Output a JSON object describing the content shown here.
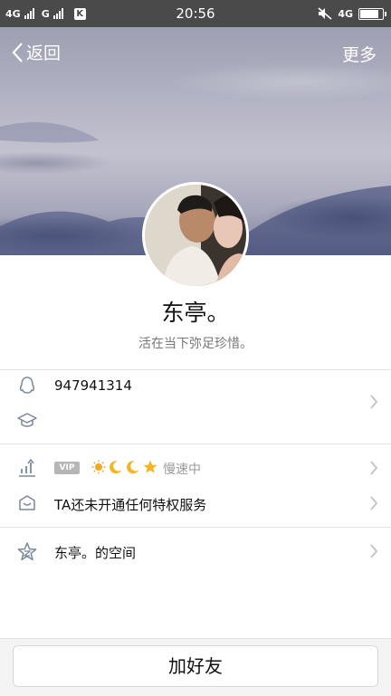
{
  "status_bar": {
    "net1": "4G",
    "net2": "G",
    "app_badge": "K",
    "time": "20:56",
    "net_right": "4G",
    "battery_level": 0.9
  },
  "nav": {
    "back_label": "返回",
    "more_label": "更多"
  },
  "profile": {
    "name": "东亭。",
    "signature": "活在当下弥足珍惜。"
  },
  "info": {
    "qq_number": "947941314"
  },
  "vip": {
    "badge": "VIP",
    "level_icons": [
      "sun-icon",
      "moon-icon",
      "moon-icon",
      "star-icon"
    ],
    "speed_status": "慢速中"
  },
  "privilege": {
    "text": "TA还未开通任何特权服务"
  },
  "space": {
    "text": "东亭。的空间"
  },
  "actions": {
    "add_friend": "加好友"
  },
  "colors": {
    "status_bar": "#4a4a4a",
    "accent_sun": "#f5a623",
    "accent_moon": "#f5b523"
  }
}
